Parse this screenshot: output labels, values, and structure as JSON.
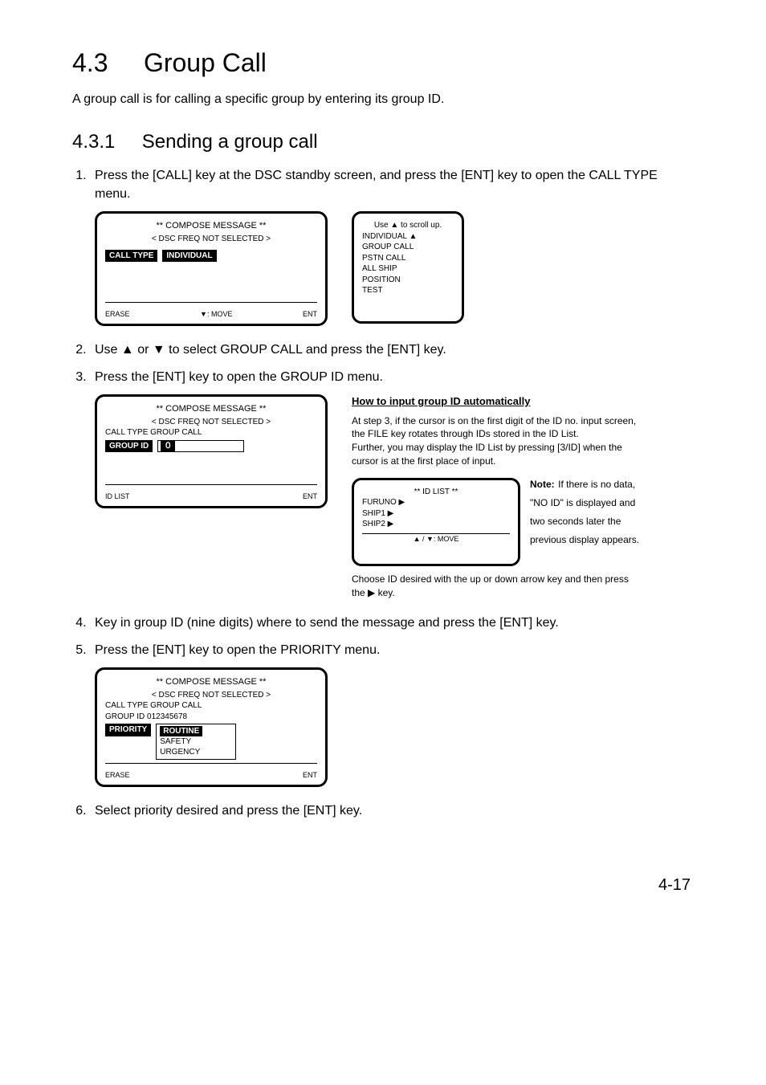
{
  "section": {
    "number": "4.3",
    "title": "Group Call",
    "intro": "A group call is for calling a specific group by entering its group ID."
  },
  "subsection": {
    "number": "4.3.1",
    "title": "Sending a group call"
  },
  "steps": {
    "s1": "Press the [CALL] key at the DSC standby screen, and press the [ENT] key to open the CALL TYPE menu.",
    "s2_a": "Use ",
    "s2_b": " or ",
    "s2_c": " to select GROUP CALL and press the [ENT] key.",
    "s3": "Press the [ENT] key to open the GROUP ID menu.",
    "s4": "Key in group ID (nine digits) where to send the message and press the [ENT] key.",
    "s5": "Press the [ENT] key to open the PRIORITY menu.",
    "s6": "Select priority desired and press the [ENT] key."
  },
  "panel1_left": {
    "line1": "** COMPOSE MESSAGE **",
    "line2": "< DSC FREQ NOT SELECTED >",
    "call_type_label": "CALL TYPE",
    "call_type_value": "INDIVIDUAL",
    "foot_left": "ERASE",
    "foot_center": "▼: MOVE",
    "foot_right": "ENT"
  },
  "panel1_right": {
    "l1": "Use ▲ to scroll up.",
    "l2": "INDIVIDUAL ▲",
    "l3": "GROUP CALL",
    "l4": "PSTN CALL",
    "l5": "ALL SHIP",
    "l6": "POSITION",
    "l7": "TEST"
  },
  "panel_group": {
    "line1": "** COMPOSE MESSAGE **",
    "line2": "< DSC FREQ NOT SELECTED >",
    "call_type": "CALL TYPE     GROUP CALL",
    "group_id_label": "GROUP ID",
    "group_id_value": "０",
    "foot_left": "ID LIST",
    "foot_center": "",
    "foot_right": "ENT"
  },
  "auto": {
    "title": "How to input group ID automatically",
    "body1": "At step 3, if the cursor is on the first digit of the ID no. input screen, the FILE key rotates through IDs stored in the ID List.",
    "body2": "Further, you may display the ID List by pressing [3/ID] when the cursor is at the first place of input.",
    "note_label": "Note:",
    "note_body": "If there is no data, \"NO ID\" is displayed and two seconds later the previous display appears.",
    "panel_title": "** ID LIST **",
    "opt1": "FURUNO     ▶",
    "opt2": "SHIP1         ▶",
    "opt3": "SHIP2         ▶",
    "panel_foot": "▲ / ▼: MOVE",
    "tail": "Choose ID desired with the up or down arrow key and then press the ▶ key."
  },
  "panel_priority": {
    "line1": "** COMPOSE MESSAGE **",
    "line2": "< DSC FREQ NOT SELECTED >",
    "call_type": "CALL TYPE   GROUP CALL",
    "group_id": "GROUP ID     012345678",
    "priority_label": "PRIORITY",
    "priority_value": "ROUTINE",
    "sub1": "SAFETY",
    "sub2": "URGENCY",
    "foot_left": "ERASE",
    "foot_right": "ENT"
  },
  "page_number": "4-17"
}
